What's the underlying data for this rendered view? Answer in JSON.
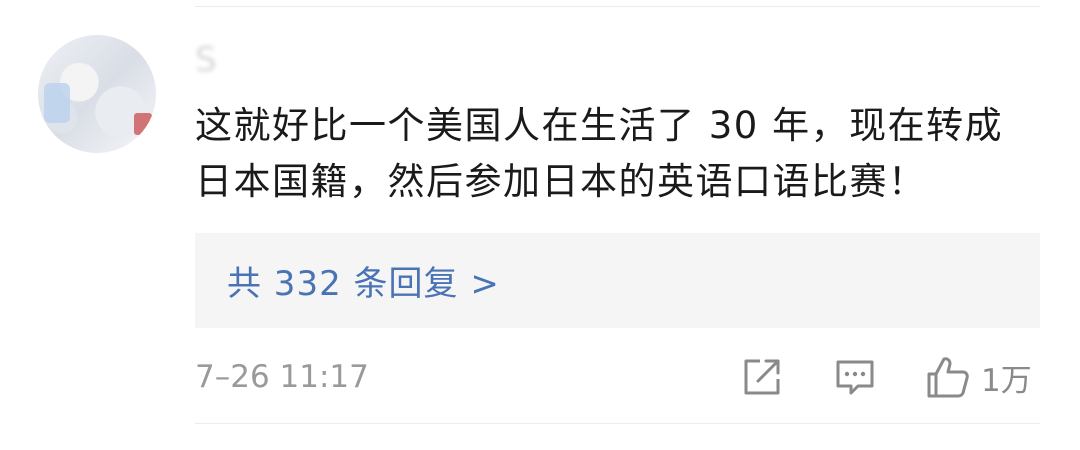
{
  "comment": {
    "username": "S",
    "text": "这就好比一个美国人在生活了 30 年，现在转成日本国籍，然后参加日本的英语口语比赛！",
    "replies_label": "共 332 条回复 >",
    "timestamp": "7–26 11:17"
  },
  "actions": {
    "share_icon": "share-icon",
    "comment_icon": "comment-icon",
    "like_icon": "thumbs-up-icon",
    "like_count": "1万"
  },
  "colors": {
    "link": "#4a73b5",
    "text": "#1a1a1a",
    "meta": "#9a9a9a",
    "reply_bg": "#f5f5f5"
  }
}
